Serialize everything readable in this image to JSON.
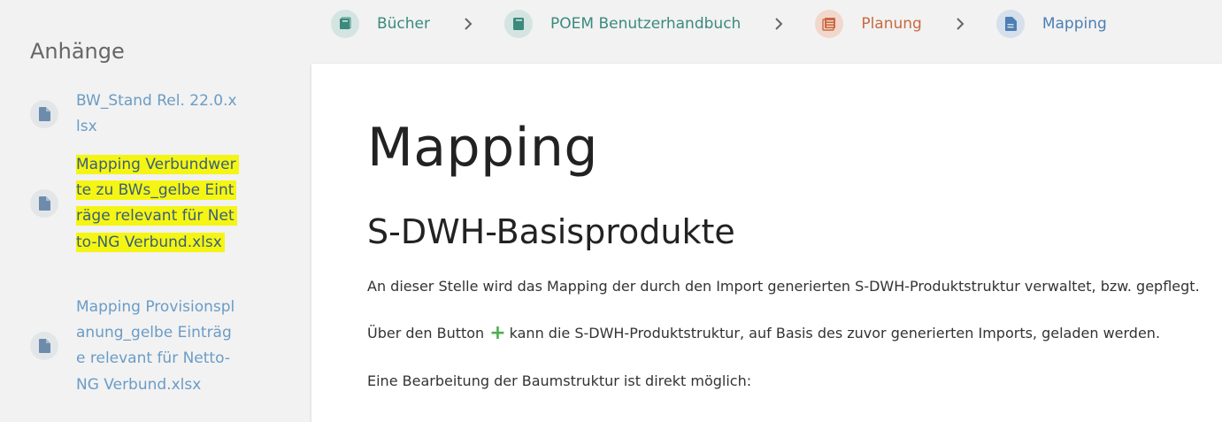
{
  "breadcrumb": {
    "items": [
      {
        "label": "Bücher",
        "icon": "bookshelf-icon",
        "color": "#3a8a7e"
      },
      {
        "label": "POEM Benutzerhandbuch",
        "icon": "book-icon",
        "color": "#3a8a7e"
      },
      {
        "label": "Planung",
        "icon": "chapter-icon",
        "color": "#c9693f"
      },
      {
        "label": "Mapping",
        "icon": "page-icon",
        "color": "#4c7fb4"
      }
    ]
  },
  "sidebar": {
    "title": "Anhänge",
    "attachments": [
      {
        "label": "BW_Stand Rel. 22.0.xlsx",
        "highlighted": false
      },
      {
        "label": "Mapping Verbundwerte zu BWs_gelbe Einträge relevant für Netto-NG Verbund.xlsx",
        "highlighted": true
      },
      {
        "label": "Mapping Provisionsplanung_gelbe Einträge relevant für Netto-NG Verbund.xlsx",
        "highlighted": false
      }
    ]
  },
  "content": {
    "page_title": "Mapping",
    "section_title": "S-DWH-Basisprodukte",
    "paragraph1": "An dieser Stelle wird das Mapping der durch den Import generierten S-DWH-Produktstruktur verwaltet, bzw. gepflegt.",
    "paragraph2_before": "Über den Button",
    "paragraph2_icon": "+",
    "paragraph2_after": "kann die S-DWH-Produktstruktur, auf Basis des zuvor generierten Imports, geladen werden.",
    "paragraph3": "Eine Bearbeitung der Baumstruktur ist direkt möglich:"
  },
  "colors": {
    "highlight": "#f5f514",
    "link": "#6a9cc6",
    "add_icon": "#4caf50"
  }
}
